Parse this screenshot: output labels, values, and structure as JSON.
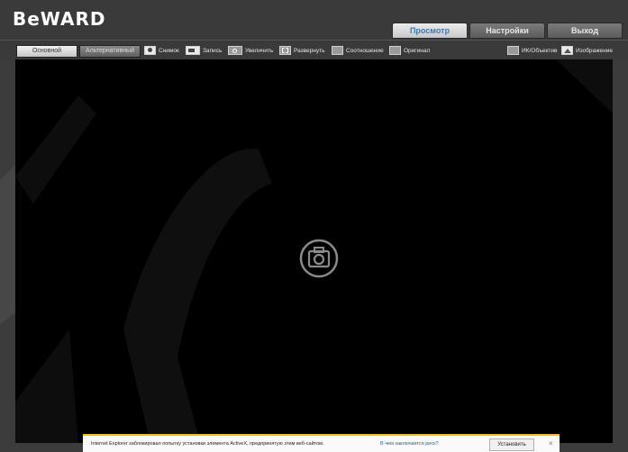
{
  "logo": {
    "text": "BeWARD"
  },
  "nav": {
    "tabs": [
      {
        "label": "Просмотр",
        "active": true
      },
      {
        "label": "Настройки",
        "active": false
      },
      {
        "label": "Выход",
        "active": false
      }
    ]
  },
  "toolbar": {
    "stream": {
      "main": "Основной",
      "alt": "Альтернативный"
    },
    "snapshot": "Снимок",
    "record": "Запись",
    "zoom": "Увеличить",
    "expand": "Развернуть",
    "ratio": "Соотношение",
    "original": "Оригинал",
    "ir_lens": "ИК/Объектив",
    "image": "Изображение"
  },
  "infobar": {
    "message": "Internet Explorer заблокировал попытку установки элемента ActiveX, предпринятую этим веб-сайтом.",
    "link": "В чем заключается риск?",
    "install": "Установить",
    "close": "×"
  },
  "colors": {
    "accent": "#4477aa",
    "ie_bar": "#f2c300",
    "video_bg": "#000000"
  }
}
